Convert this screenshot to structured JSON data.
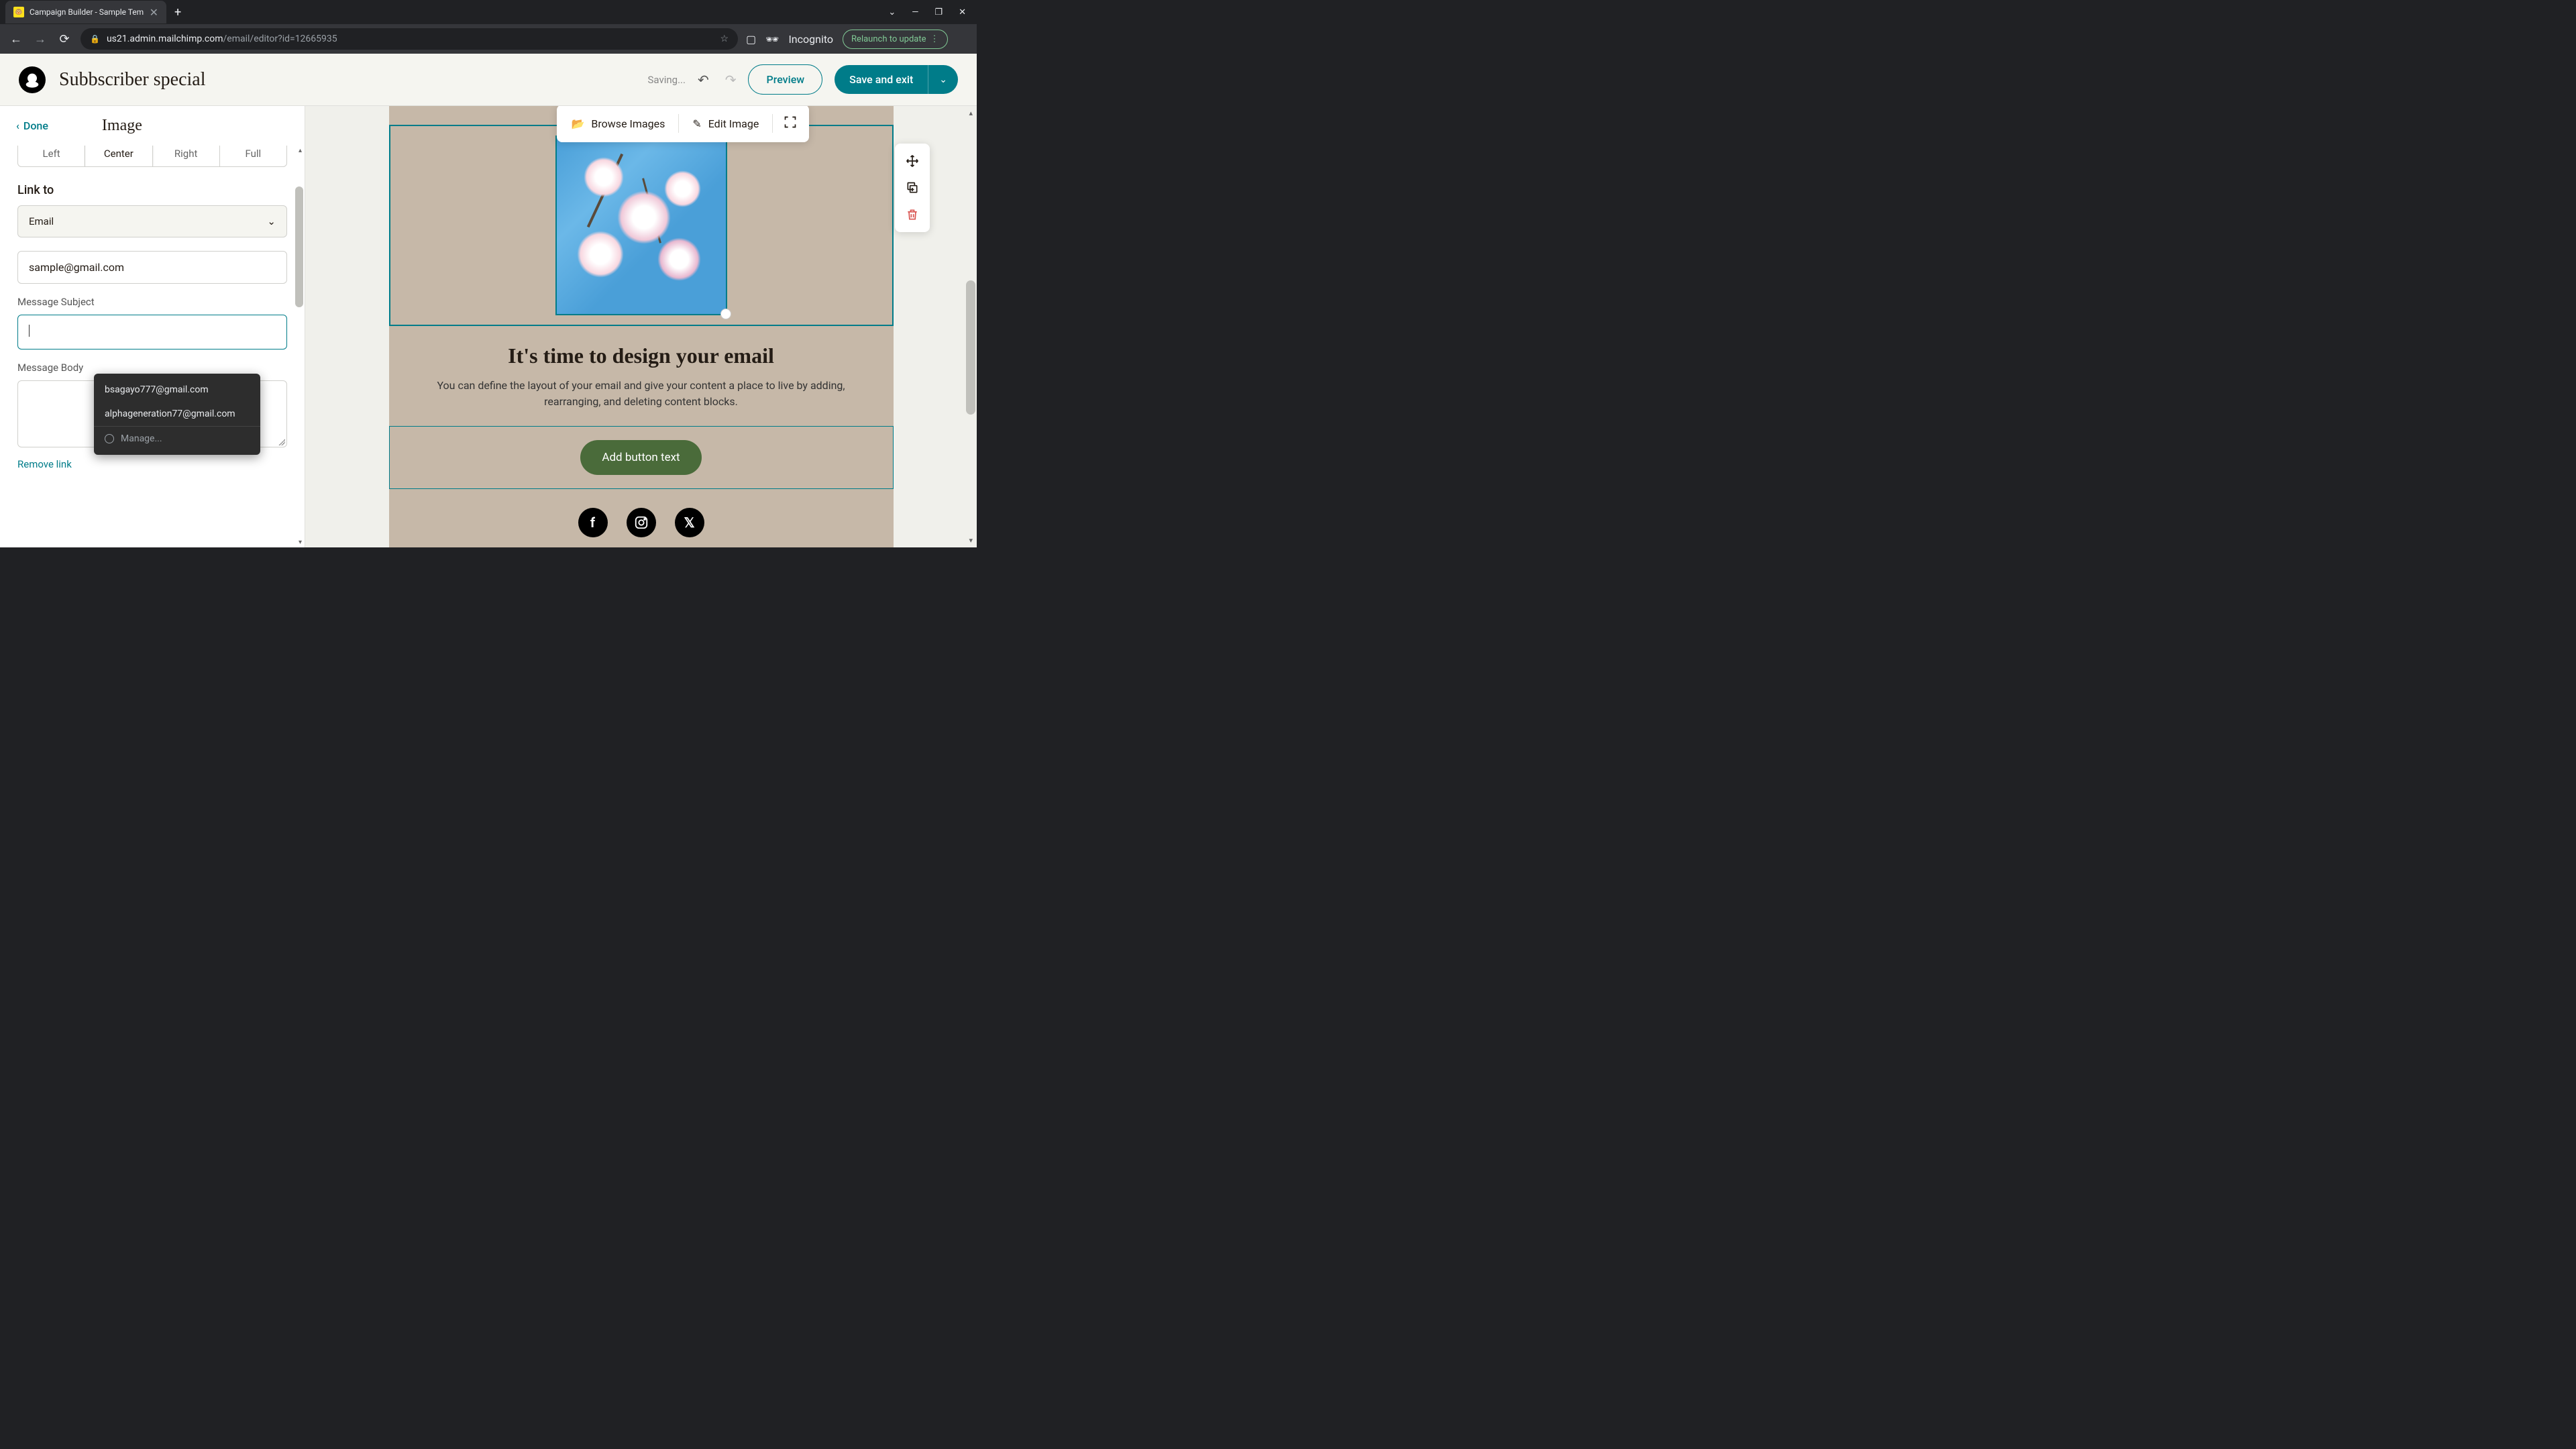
{
  "browser": {
    "tab_title": "Campaign Builder - Sample Tem",
    "url_host": "us21.admin.mailchimp.com",
    "url_path": "/email/editor?id=12665935",
    "incognito": "Incognito",
    "relaunch": "Relaunch to update",
    "window": {
      "chevron": "⌄",
      "min": "—",
      "restore": "❐",
      "close": "✕"
    }
  },
  "header": {
    "campaign_name": "Subbscriber special",
    "saving": "Saving...",
    "preview": "Preview",
    "save": "Save and exit"
  },
  "sidebar": {
    "done": "Done",
    "title": "Image",
    "align": {
      "left": "Left",
      "center": "Center",
      "right": "Right",
      "full": "Full"
    },
    "link_to_label": "Link to",
    "link_type": "Email",
    "email_value": "sample@gmail.com",
    "subject_label": "Message Subject",
    "body_label": "Message Body",
    "remove_link": "Remove link"
  },
  "autocomplete": {
    "items": [
      "bsagayo777@gmail.com",
      "alphageneration77@gmail.com"
    ],
    "manage": "Manage..."
  },
  "canvas": {
    "browse_images": "Browse Images",
    "edit_image": "Edit Image",
    "heading": "It's time to design your email",
    "body": "You can define the layout of your email and give your content a place to live by adding, rearranging, and deleting content blocks.",
    "button_text": "Add button text"
  }
}
